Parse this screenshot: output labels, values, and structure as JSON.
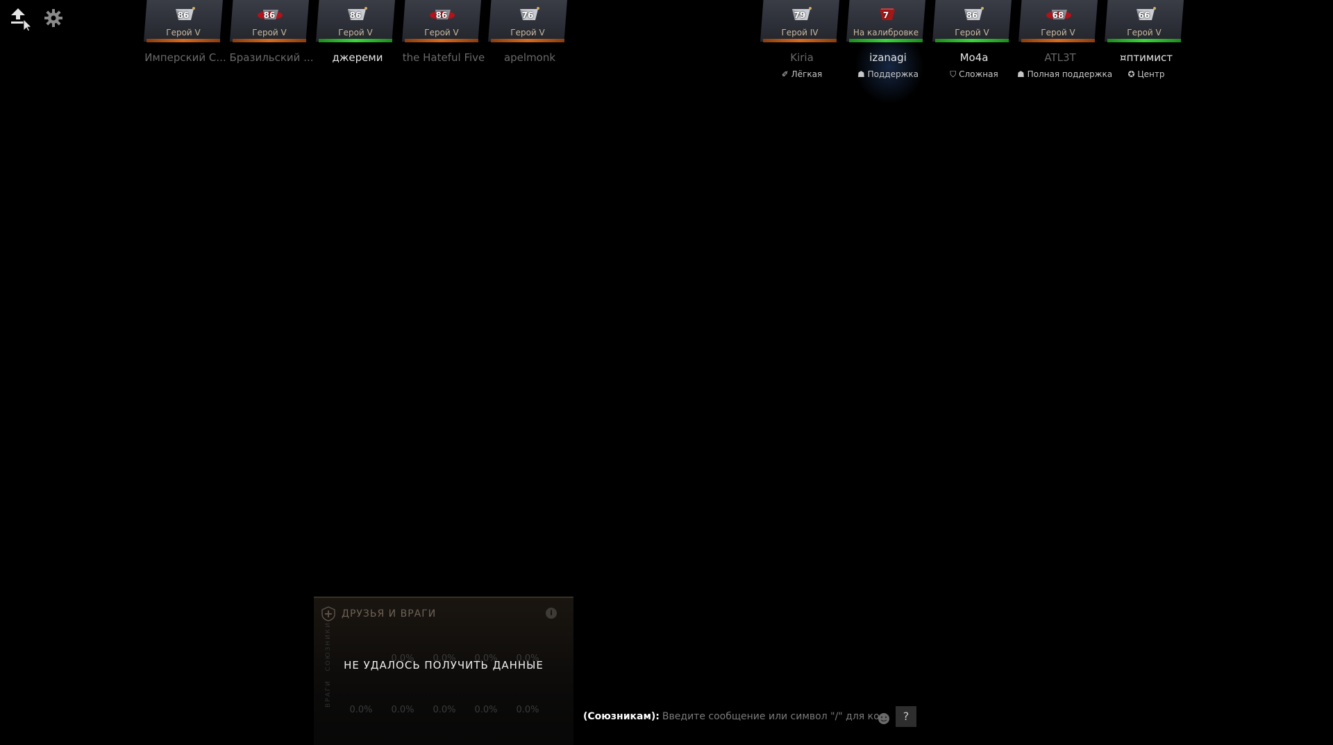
{
  "toolbar": {
    "upload_icon": "upload-arrow-icon",
    "settings_icon": "gear-icon"
  },
  "radiant": [
    {
      "rank_number": "86",
      "rank_label": "Герой V",
      "name": "Имперский С...",
      "name_style": "dim",
      "bar": "orange",
      "medal": "silver"
    },
    {
      "rank_number": "86",
      "rank_label": "Герой V",
      "name": "Бразильский ...",
      "name_style": "dim",
      "bar": "orange",
      "medal": "red"
    },
    {
      "rank_number": "86",
      "rank_label": "Герой V",
      "name": "джереми",
      "name_style": "bright",
      "bar": "green",
      "medal": "silver"
    },
    {
      "rank_number": "86",
      "rank_label": "Герой V",
      "name": "the Hateful Five",
      "name_style": "dim",
      "bar": "orange",
      "medal": "red"
    },
    {
      "rank_number": "76",
      "rank_label": "Герой V",
      "name": "apelmonk",
      "name_style": "dim",
      "bar": "orange",
      "medal": "silver"
    }
  ],
  "dire": [
    {
      "rank_number": "79",
      "rank_label": "Герой IV",
      "name": "Kiria",
      "name_style": "dim",
      "bar": "orange",
      "medal": "silver",
      "role": "Лёгкая",
      "role_icon": "✐"
    },
    {
      "rank_number": "7",
      "rank_label": "На калибровке",
      "name": "izanagi",
      "name_style": "bright",
      "bar": "green",
      "medal": "calibration",
      "role": "Поддержка",
      "role_icon": "☗"
    },
    {
      "rank_number": "86",
      "rank_label": "Герой V",
      "name": "Mo4a",
      "name_style": "bright",
      "bar": "green",
      "medal": "silver",
      "role": "Сложная",
      "role_icon": "⛉"
    },
    {
      "rank_number": "68",
      "rank_label": "Герой V",
      "name": "ATL3T",
      "name_style": "dim",
      "bar": "orange",
      "medal": "red",
      "role": "Полная поддержка",
      "role_icon": "☗"
    },
    {
      "rank_number": "66",
      "rank_label": "Герой V",
      "name": "¤птимиcт",
      "name_style": "bright",
      "bar": "green",
      "medal": "silver",
      "role": "Центр",
      "role_icon": "✪"
    }
  ],
  "friends_enemies": {
    "title": "ДРУЗЬЯ И ВРАГИ",
    "friends_side": "СОЮЗНИКИ",
    "enemies_side": "ВРАГИ",
    "friends_values": [
      "0.0%",
      "0.0%",
      "0.0%",
      "0.0%",
      "0.0%"
    ],
    "enemies_values": [
      "0.0%",
      "0.0%",
      "0.0%",
      "0.0%",
      "0.0%"
    ],
    "error": "НЕ УДАЛОСЬ ПОЛУЧИТЬ ДАННЫЕ"
  },
  "chat": {
    "prefix": "(Союзникам):",
    "placeholder": "Введите сообщение или символ \"/\" для ко...",
    "help_label": "?"
  },
  "colors": {
    "bar_orange": "#d86a1d",
    "bar_green": "#3ad43a"
  }
}
